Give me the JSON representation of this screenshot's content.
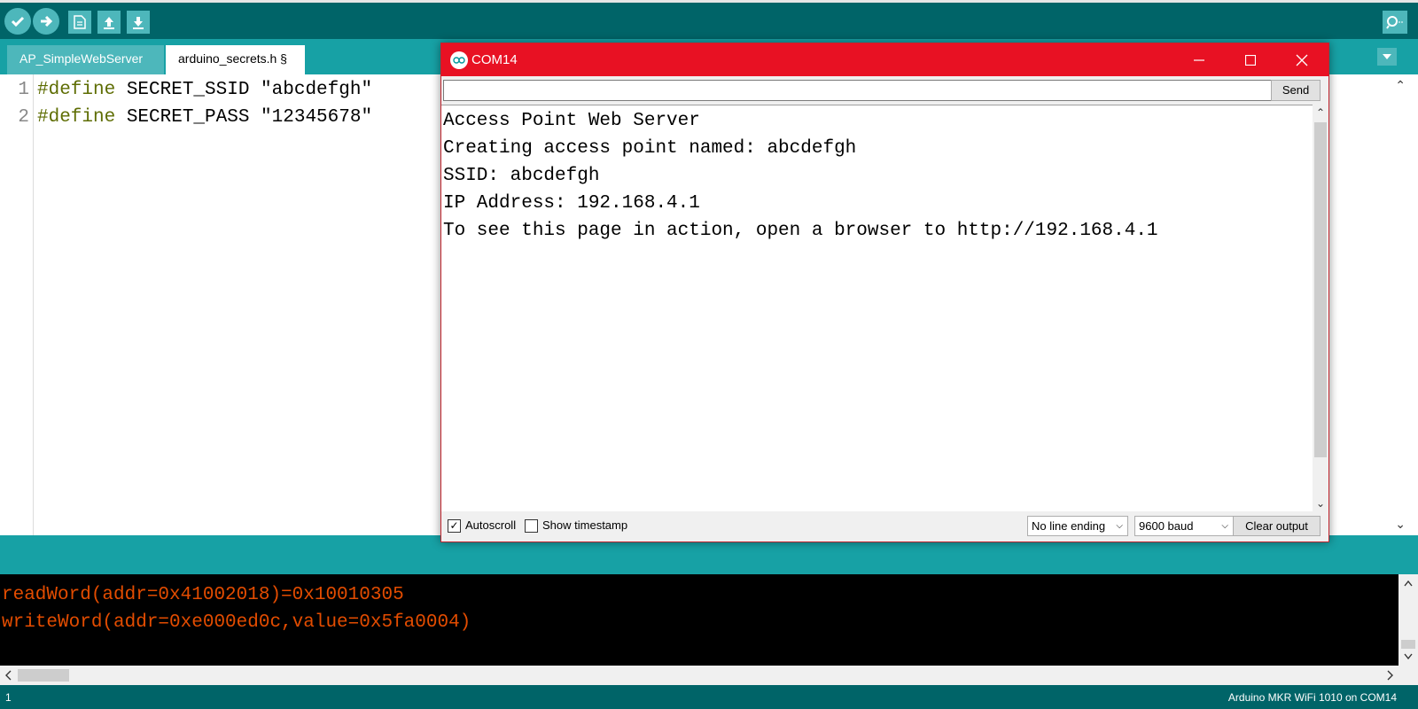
{
  "toolbar": {
    "verify_icon": "check-icon",
    "upload_icon": "arrow-right-icon",
    "new_icon": "document-icon",
    "open_icon": "arrow-up-icon",
    "save_icon": "arrow-down-icon",
    "serial_monitor_icon": "magnifier-icon"
  },
  "tabs": [
    {
      "label": "AP_SimpleWebServer"
    },
    {
      "label": "arduino_secrets.h §"
    }
  ],
  "editor": {
    "lines": [
      {
        "number": "1",
        "keyword": "#define",
        "name": " SECRET_SSID ",
        "value": "\"abcdefgh\""
      },
      {
        "number": "2",
        "keyword": "#define",
        "name": " SECRET_PASS ",
        "value": "\"12345678\""
      }
    ]
  },
  "console": {
    "lines": [
      "readWord(addr=0x41002018)=0x10010305",
      "writeWord(addr=0xe000ed0c,value=0x5fa0004)"
    ]
  },
  "status": {
    "line": "1",
    "board": "Arduino MKR WiFi 1010 on COM14"
  },
  "serial_monitor": {
    "title": "COM14",
    "input_value": "",
    "send_label": "Send",
    "output": [
      "Access Point Web Server",
      "Creating access point named: abcdefgh",
      "SSID: abcdefgh",
      "IP Address: 192.168.4.1",
      "To see this page in action, open a browser to http://192.168.4.1"
    ],
    "autoscroll_label": "Autoscroll",
    "autoscroll_checked": true,
    "timestamp_label": "Show timestamp",
    "timestamp_checked": false,
    "line_ending": "No line ending",
    "baud": "9600 baud",
    "clear_label": "Clear output"
  },
  "colors": {
    "toolbar": "#006468",
    "tabs_bar": "#17a1a5",
    "button": "#4db7bb",
    "console_text": "#e34c00",
    "serial_title": "#e81123"
  }
}
